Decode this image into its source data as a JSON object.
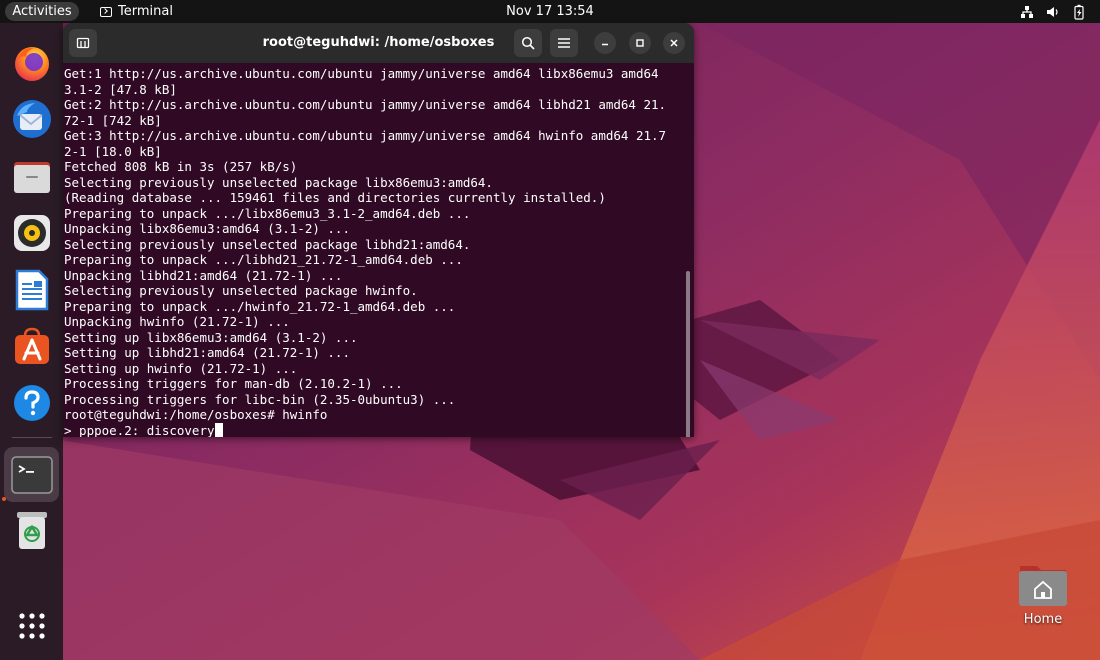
{
  "topbar": {
    "activities_label": "Activities",
    "app_name": "Terminal",
    "datetime": "Nov 17  13:54"
  },
  "dock": {
    "items": [
      {
        "name": "Firefox",
        "icon": "firefox-icon"
      },
      {
        "name": "Thunderbird",
        "icon": "thunderbird-icon"
      },
      {
        "name": "Files",
        "icon": "files-icon"
      },
      {
        "name": "Rhythmbox",
        "icon": "rhythmbox-icon"
      },
      {
        "name": "LibreOffice Writer",
        "icon": "writer-icon"
      },
      {
        "name": "Ubuntu Software",
        "icon": "software-icon"
      },
      {
        "name": "Help",
        "icon": "help-icon"
      },
      {
        "name": "Terminal",
        "icon": "terminal-icon",
        "running": true
      },
      {
        "name": "Trash",
        "icon": "trash-icon"
      },
      {
        "name": "Show Applications",
        "icon": "app-grid-icon"
      }
    ]
  },
  "terminal": {
    "title": "root@teguhdwi: /home/osboxes",
    "lines": [
      "Get:1 http://us.archive.ubuntu.com/ubuntu jammy/universe amd64 libx86emu3 amd64",
      "3.1-2 [47.8 kB]",
      "Get:2 http://us.archive.ubuntu.com/ubuntu jammy/universe amd64 libhd21 amd64 21.",
      "72-1 [742 kB]",
      "Get:3 http://us.archive.ubuntu.com/ubuntu jammy/universe amd64 hwinfo amd64 21.7",
      "2-1 [18.0 kB]",
      "Fetched 808 kB in 3s (257 kB/s)",
      "Selecting previously unselected package libx86emu3:amd64.",
      "(Reading database ... 159461 files and directories currently installed.)",
      "Preparing to unpack .../libx86emu3_3.1-2_amd64.deb ...",
      "Unpacking libx86emu3:amd64 (3.1-2) ...",
      "Selecting previously unselected package libhd21:amd64.",
      "Preparing to unpack .../libhd21_21.72-1_amd64.deb ...",
      "Unpacking libhd21:amd64 (21.72-1) ...",
      "Selecting previously unselected package hwinfo.",
      "Preparing to unpack .../hwinfo_21.72-1_amd64.deb ...",
      "Unpacking hwinfo (21.72-1) ...",
      "Setting up libx86emu3:amd64 (3.1-2) ...",
      "Setting up libhd21:amd64 (21.72-1) ...",
      "Setting up hwinfo (21.72-1) ...",
      "Processing triggers for man-db (2.10.2-1) ...",
      "Processing triggers for libc-bin (2.35-0ubuntu3) ...",
      "root@teguhdwi:/home/osboxes# hwinfo",
      "> pppoe.2: discovery"
    ],
    "background": "#300a24",
    "text_color": "#ffffff"
  },
  "desktop": {
    "home_label": "Home"
  },
  "colors": {
    "accent": "#e95420",
    "topbar": "#141414",
    "dock": "#2a1b26"
  }
}
